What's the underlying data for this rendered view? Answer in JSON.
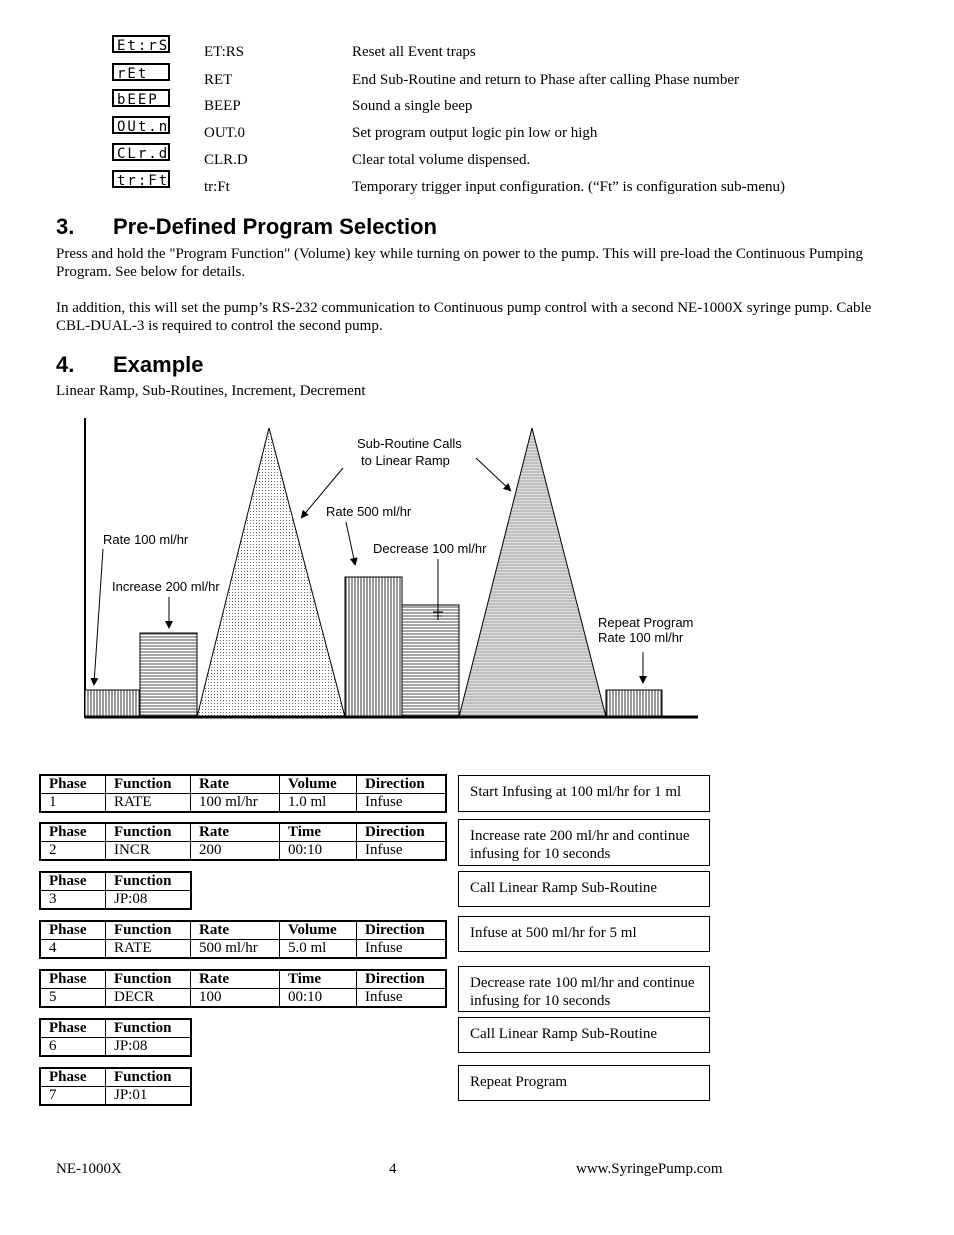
{
  "commands": [
    {
      "lcd": "Et:rS",
      "code": "ET:RS",
      "desc": "Reset all Event traps"
    },
    {
      "lcd": "rEt",
      "code": "RET",
      "desc": "End Sub-Routine and return to Phase after calling Phase number"
    },
    {
      "lcd": "bEEP",
      "code": "BEEP",
      "desc": "Sound a single beep"
    },
    {
      "lcd": "OUt.n",
      "code": "OUT.0",
      "desc": "Set program output logic pin low or high"
    },
    {
      "lcd": "CLr.d",
      "code": "CLR.D",
      "desc": "Clear total volume dispensed."
    },
    {
      "lcd": "tr:Ft",
      "code": "tr:Ft",
      "desc": "Temporary trigger input configuration.  (“Ft” is configuration sub-menu)"
    }
  ],
  "section3": {
    "number": "3.",
    "title": "Pre-Defined Program Selection",
    "p1": "Press and hold the \"Program Function\" (Volume) key while turning on power to the pump.  This will pre-load the Continuous Pumping Program.  See below for details.",
    "p2": "In addition, this will set the pump’s RS-232 communication to Continuous pump control with a second NE-1000X syringe pump.  Cable CBL-DUAL-3 is required to control the second pump."
  },
  "section4": {
    "number": "4.",
    "title": "Example",
    "subtitle": "Linear Ramp, Sub-Routines, Increment, Decrement"
  },
  "diagram": {
    "labels": {
      "rate100": "Rate 100 ml/hr",
      "inc200": "Increase 200 ml/hr",
      "sub1": "Sub-Routine Calls",
      "sub2": "to Linear Ramp",
      "rate500": "Rate 500 ml/hr",
      "dec100": "Decrease 100 ml/hr",
      "repeat1": "Repeat Program",
      "repeat2": "Rate 100 ml/hr"
    }
  },
  "phases": [
    {
      "headers": [
        "Phase",
        "Function",
        "Rate",
        "Volume",
        "Direction"
      ],
      "values": [
        "1",
        "RATE",
        "100 ml/hr",
        "1.0 ml",
        "Infuse"
      ],
      "note": "Start Infusing at 100 ml/hr for 1 ml"
    },
    {
      "headers": [
        "Phase",
        "Function",
        "Rate",
        "Time",
        "Direction"
      ],
      "values": [
        "2",
        "INCR",
        "200",
        "00:10",
        "Infuse"
      ],
      "note": "Increase rate 200 ml/hr and continue infusing for 10 seconds"
    },
    {
      "headers": [
        "Phase",
        "Function"
      ],
      "values": [
        "3",
        "JP:08"
      ],
      "note": "Call Linear Ramp Sub-Routine"
    },
    {
      "headers": [
        "Phase",
        "Function",
        "Rate",
        "Volume",
        "Direction"
      ],
      "values": [
        "4",
        "RATE",
        "500 ml/hr",
        "5.0 ml",
        "Infuse"
      ],
      "note": "Infuse at 500 ml/hr for 5 ml"
    },
    {
      "headers": [
        "Phase",
        "Function",
        "Rate",
        "Time",
        "Direction"
      ],
      "values": [
        "5",
        "DECR",
        "100",
        "00:10",
        "Infuse"
      ],
      "note": "Decrease rate 100 ml/hr and continue infusing for 10 seconds"
    },
    {
      "headers": [
        "Phase",
        "Function"
      ],
      "values": [
        "6",
        "JP:08"
      ],
      "note": "Call Linear Ramp Sub-Routine"
    },
    {
      "headers": [
        "Phase",
        "Function"
      ],
      "values": [
        "7",
        "JP:01"
      ],
      "note": "Repeat Program"
    }
  ],
  "footer": {
    "left": "NE-1000X",
    "page": "4",
    "right": "www.SyringePump.com"
  }
}
